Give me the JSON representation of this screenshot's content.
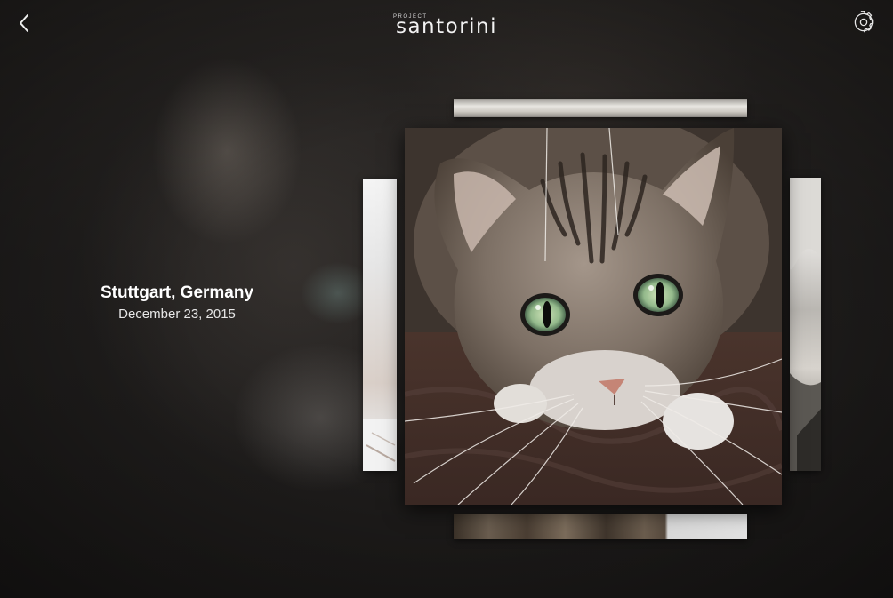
{
  "header": {
    "brand_small": "PROJECT",
    "brand_name": "santorini"
  },
  "photo": {
    "location": "Stuttgart, Germany",
    "date": "December 23, 2015"
  },
  "icons": {
    "back": "chevron-left-icon",
    "settings": "gear-icon"
  },
  "colors": {
    "background": "#1f1d1c",
    "text": "#ffffff"
  }
}
